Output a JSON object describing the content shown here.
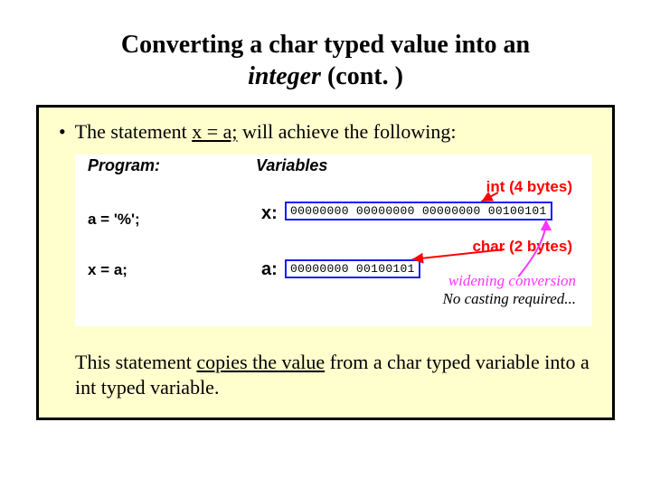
{
  "title": {
    "line1": "Converting a char typed value into an",
    "emph": "integer",
    "line2_rest": " (cont. )"
  },
  "bullet": {
    "dot": "•",
    "pre": "The statement ",
    "u": "x = a;",
    "post": " will achieve the following:"
  },
  "diagram": {
    "headers": {
      "program": "Program:",
      "variables": "Variables"
    },
    "int_label": "int (4 bytes)",
    "char_label": "char (2 bytes)",
    "code": {
      "line1": "a = '%';",
      "line2": "x = a;"
    },
    "vars": {
      "x_name": "x:",
      "x_bits": "00000000 00000000 00000000 00100101",
      "a_name": "a:",
      "a_bits": "00000000 00100101"
    },
    "widening": "widening conversion",
    "nocast": "No casting required..."
  },
  "closing": {
    "pre": "This statement ",
    "u": "copies the value",
    "post": " from a char typed variable into a int typed variable."
  }
}
